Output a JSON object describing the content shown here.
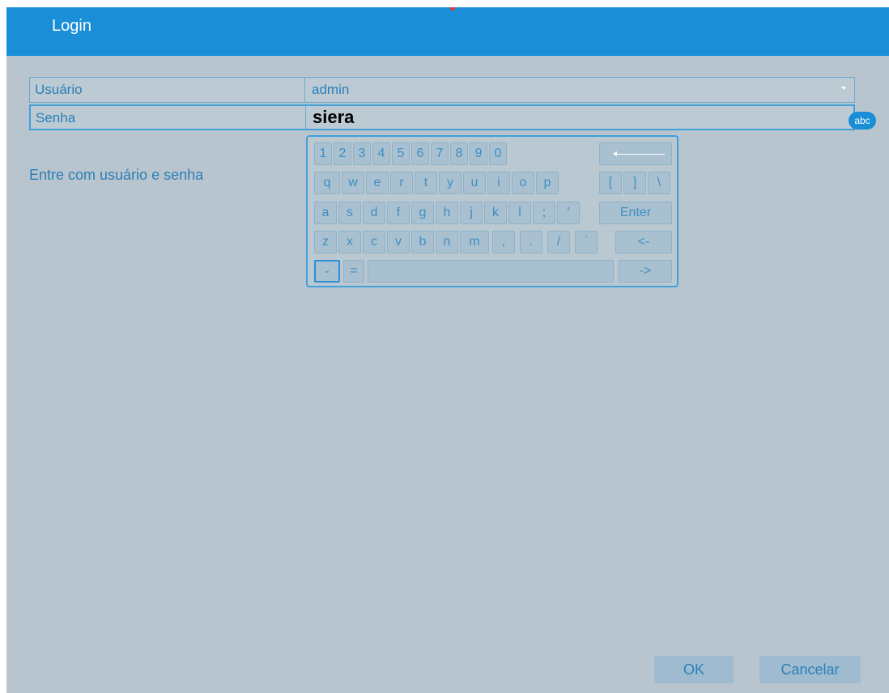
{
  "window": {
    "title": "Login"
  },
  "form": {
    "user": {
      "label": "Usuário",
      "value": "admin"
    },
    "password": {
      "label": "Senha",
      "value": "siera"
    },
    "input_mode_badge": "abc"
  },
  "hint": "Entre com usuário e senha",
  "keyboard": {
    "row1": [
      "1",
      "2",
      "3",
      "4",
      "5",
      "6",
      "7",
      "8",
      "9",
      "0"
    ],
    "row2": [
      "q",
      "w",
      "e",
      "r",
      "t",
      "y",
      "u",
      "i",
      "o",
      "p",
      "[",
      "]",
      "\\"
    ],
    "row3": [
      "a",
      "s",
      "d",
      "f",
      "g",
      "h",
      "j",
      "k",
      "l",
      ";",
      "'"
    ],
    "enter": "Enter",
    "row4": [
      "z",
      "x",
      "c",
      "v",
      "b",
      "n",
      "m",
      ",",
      ".",
      "/",
      "`"
    ],
    "left_arrow": "<-",
    "row5_small": [
      "-",
      "="
    ],
    "right_arrow": "->"
  },
  "buttons": {
    "ok": "OK",
    "cancel": "Cancelar"
  },
  "colors": {
    "titlebar": "#1a8fd8",
    "background": "#b8c5ce",
    "accent": "#3fa0dc"
  }
}
